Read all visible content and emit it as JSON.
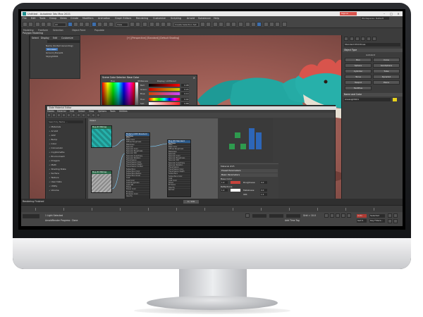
{
  "app": {
    "title": "Untitled - Autodesk 3ds Max 2021",
    "search_label": "Sign In",
    "window_controls": [
      "–",
      "□",
      "×"
    ]
  },
  "menubar": {
    "items": [
      "File",
      "Edit",
      "Tools",
      "Group",
      "Views",
      "Create",
      "Modifiers",
      "Animation",
      "Graph Editors",
      "Rendering",
      "Customize",
      "Scripting",
      "Arnold",
      "Substance",
      "Help"
    ],
    "workspace": "Workspaces: Default"
  },
  "toolbar": {
    "selection_set": "Create Selection Set",
    "filter": "All",
    "view": "View"
  },
  "ribbon": {
    "tabs": [
      "Modeling",
      "Freeform",
      "Selection",
      "Object Paint",
      "Populate"
    ],
    "active_sub": "Polygon Modeling"
  },
  "viewport": {
    "label": "[+] [Perspective] [Standard] [Default Shading]"
  },
  "scene_explorer": {
    "tabs": [
      "Select",
      "Display",
      "Edit",
      "Customize"
    ],
    "rows": [
      "Name (Sorted Ascending)",
      "Dinosaur",
      "Ground_Plane01",
      "Skylight001"
    ]
  },
  "color_dialog": {
    "title": "Scene Color Selector: Base Color",
    "hue_label": "Hue",
    "whiteness_label": "Whiteness",
    "display_mode": "Display: Unfiltered",
    "channels": [
      {
        "name": "Red:",
        "value": "0.98"
      },
      {
        "name": "Green:",
        "value": "0.24"
      },
      {
        "name": "Blue:",
        "value": "0.14"
      },
      {
        "name": "Hue:",
        "value": "0.02"
      },
      {
        "name": "Sat:",
        "value": "0.88"
      },
      {
        "name": "Value:",
        "value": "0.98"
      }
    ],
    "reset_label": "Reset",
    "ok_label": "OK",
    "cancel_label": "Cancel",
    "base_color": "#c8433c"
  },
  "material_editor": {
    "title": "Slate Material Editor",
    "menu": [
      "Modes",
      "Material",
      "Edit",
      "Select",
      "View",
      "Options",
      "Tools",
      "Utilities"
    ],
    "view_label": "View1",
    "browser_search": "Search by Name ...",
    "browser_items": [
      "Materials",
      "Arnold",
      "AOV",
      "Bump",
      "Color",
      "Conversion",
      "Cryptomatte",
      "Environment",
      "Imagers",
      "Math",
      "Shading State",
      "Surface",
      "Texture",
      "User Data",
      "Utility",
      "Volume"
    ],
    "nodes": [
      {
        "title": "Map #3 Bitmap",
        "slots": [
          "Color",
          "Alpha",
          "Mono"
        ]
      },
      {
        "title": "Material #25 Standard Surface",
        "slots": [
          "Base",
          "Base Color",
          "Diffuse Roughness",
          "Metalness",
          "Specular",
          "Specular Color",
          "Specular Roughness",
          "Specular IOR",
          "Specular Anisotropy",
          "Specular Rotation",
          "Transmission",
          "Transmission Color",
          "Transmission Depth",
          "Transmission Scatter",
          "Subsurface",
          "Subsurface Color",
          "Subsurface Radius",
          "Subsurface Scale",
          "Coat",
          "Coat Color",
          "Coat Roughness",
          "Coat IOR",
          "Sheen",
          "Sheen Color",
          "Emission",
          "Emission Color",
          "Opacity",
          "Normal",
          "Thin Walled"
        ]
      },
      {
        "title": "Map #4 Bitmap",
        "slots": [
          "Color",
          "Alpha",
          "Mono"
        ]
      },
      {
        "title": "Map #6 Standard Surface",
        "slots": [
          "Base",
          "Base Color",
          "Diffuse Roughness",
          "Metalness",
          "Specular",
          "Specular Color",
          "Specular Roughness",
          "Specular IOR",
          "Specular Anisotropy",
          "Specular Rotation",
          "Transmission",
          "Transmission Color",
          "Transmission Depth",
          "Subsurface",
          "Subsurface Color",
          "Coat",
          "Coat Color",
          "Sheen",
          "Emission",
          "Opacity",
          "Normal"
        ]
      }
    ],
    "params": {
      "title": "Material #25",
      "r1": "Preset Parameters",
      "r2": "Basic Parameters",
      "base_label": "Base Color",
      "base_value": "1.0",
      "roughness_label": "Roughness:",
      "roughness_value": "0.0",
      "reflect_label": "Reflections",
      "reflect_value": "1.0",
      "metal_label": "Metalness:",
      "metal_value": "0.0",
      "ior_label": "IOR:",
      "ior_value": "1.5"
    }
  },
  "command_panel": {
    "dropdown": "Standard Primitives",
    "object_type": "Object Type",
    "autogrid": "AutoGrid",
    "buttons": [
      "Box",
      "Cone",
      "Sphere",
      "GeoSphere",
      "Cylinder",
      "Tube",
      "Torus",
      "Pyramid",
      "Teapot",
      "Plane",
      "TextPlus"
    ],
    "name_color": "Name and Color",
    "object_name": "AreaLight001",
    "name_color_hex": "#e8d21c"
  },
  "timebar": {
    "left": "Rendering Finished",
    "frame": "0 / 100"
  },
  "status": {
    "selected": "1 Light Selected",
    "prompt": "ArnoldRender Progress : Done",
    "grid": "Grid = 10.0",
    "add_time_tag": "Add Time Tag",
    "auto": "Auto",
    "set_key": "Set K.",
    "selected_filter": "Selected",
    "key_filters": "Key Filters..."
  }
}
